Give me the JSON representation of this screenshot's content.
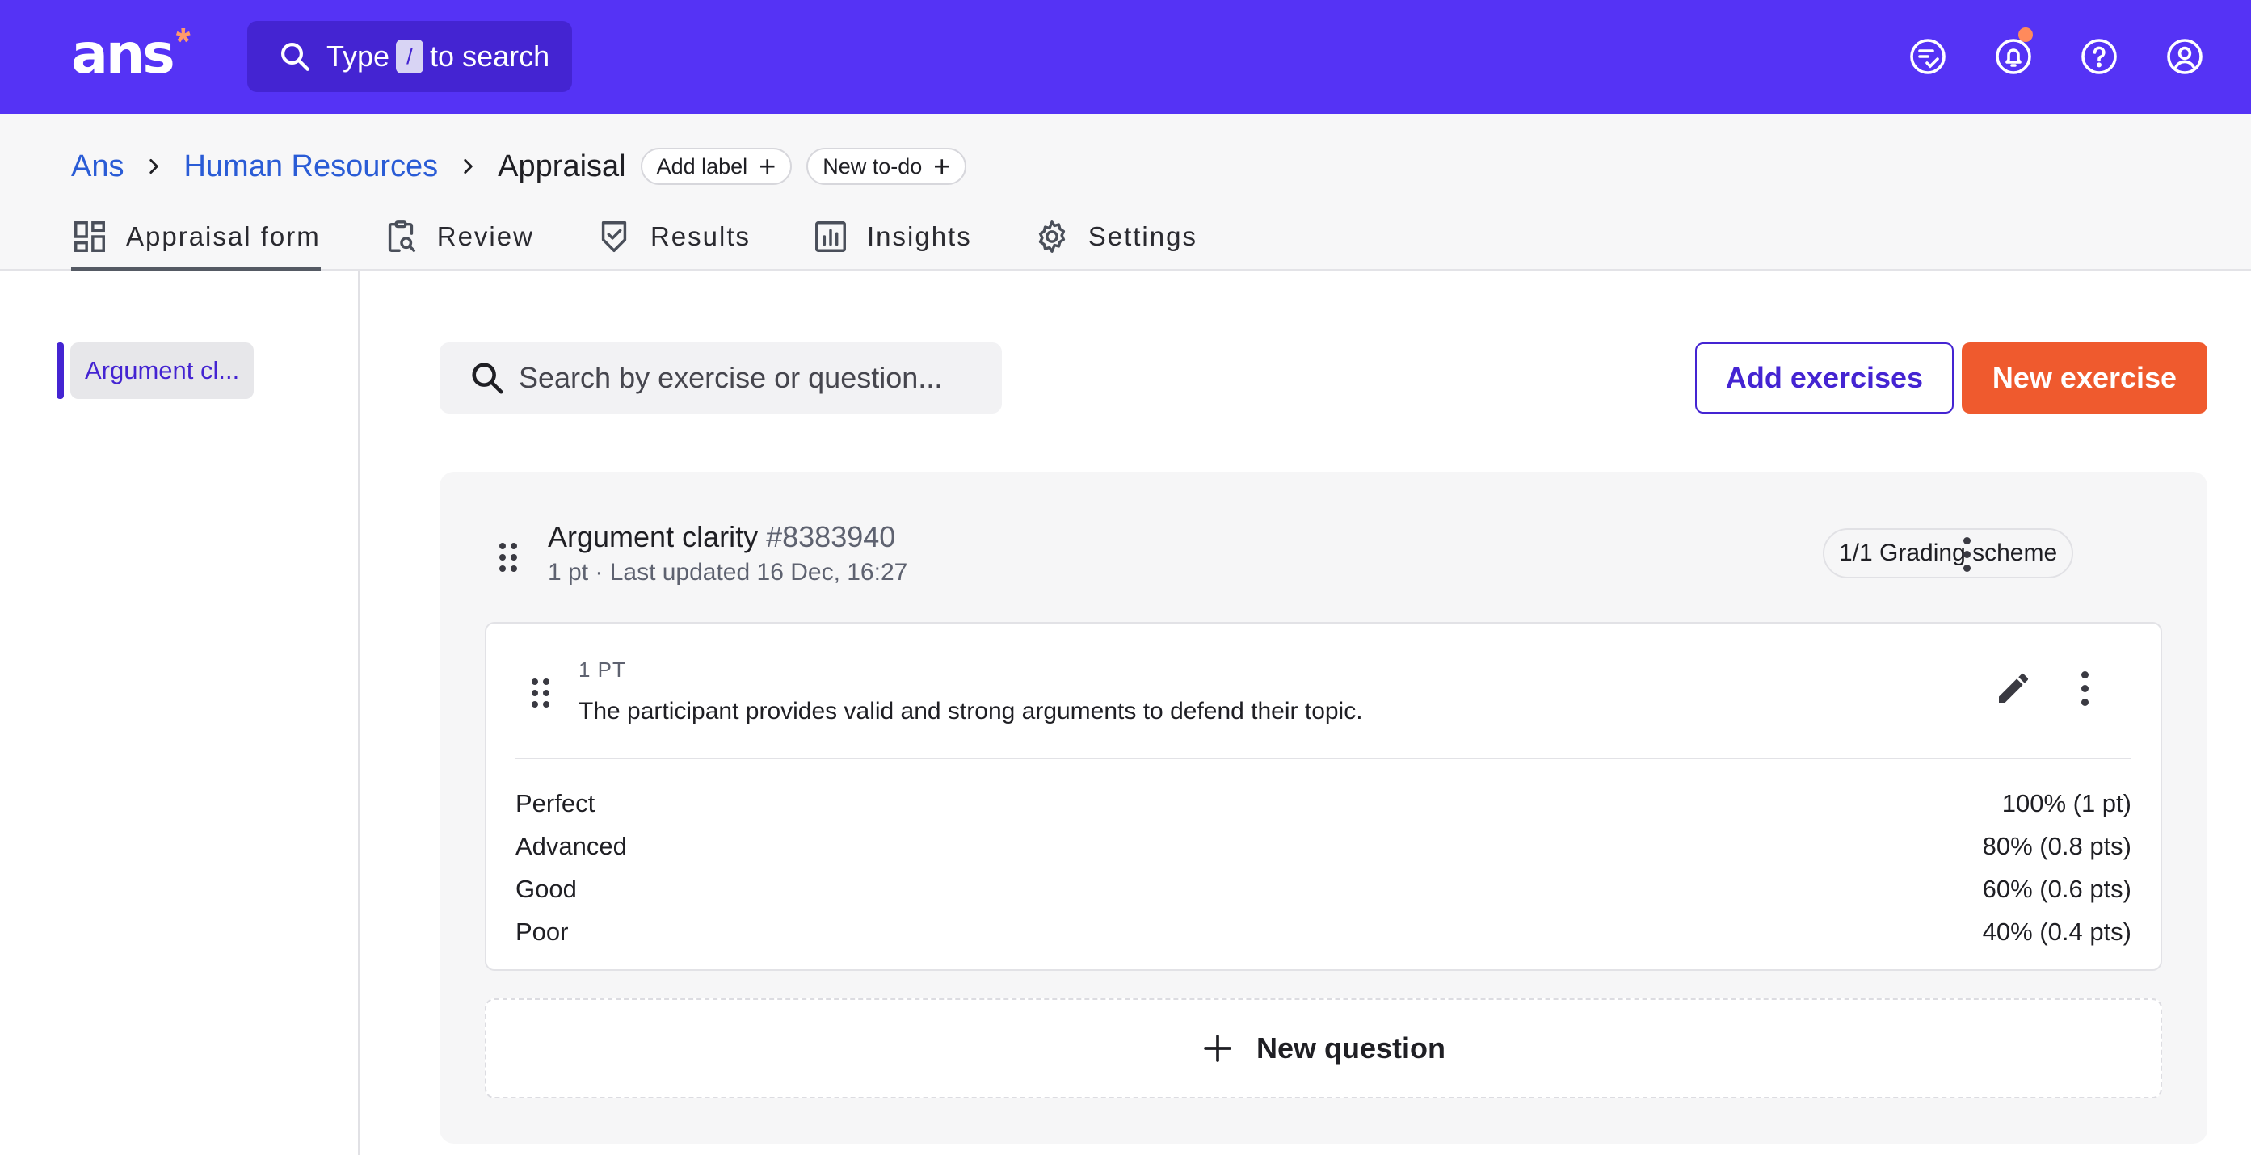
{
  "app": {
    "logo_text": "ans",
    "logo_mark": "*",
    "search": {
      "prefix": "Type",
      "key": "/",
      "suffix": "to search"
    },
    "colors": {
      "brand": "#5533f5",
      "accent": "#ef5a2e",
      "link": "#2a5cd6",
      "notification_dot": "#ff8a5c"
    },
    "top_icons": [
      "todo-list-icon",
      "bell-icon",
      "help-icon",
      "account-icon"
    ]
  },
  "breadcrumb": {
    "items": [
      "Ans",
      "Human Resources"
    ],
    "current": "Appraisal",
    "add_label": "Add label",
    "new_todo": "New to-do"
  },
  "tabs": [
    {
      "label": "Appraisal form",
      "icon": "dashboard-icon",
      "active": true
    },
    {
      "label": "Review",
      "icon": "clipboard-search-icon",
      "active": false
    },
    {
      "label": "Results",
      "icon": "shield-check-icon",
      "active": false
    },
    {
      "label": "Insights",
      "icon": "bar-chart-icon",
      "active": false
    },
    {
      "label": "Settings",
      "icon": "gear-icon",
      "active": false
    }
  ],
  "sidebar": {
    "items": [
      {
        "label": "Argument cl...",
        "active": true
      }
    ]
  },
  "main": {
    "search_placeholder": "Search by exercise or question...",
    "add_exercises": "Add exercises",
    "new_exercise": "New exercise",
    "exercise": {
      "title": "Argument clarity",
      "id": "#8383940",
      "meta": "1 pt · Last updated 16 Dec, 16:27",
      "grading_chip": "1/1 Grading scheme",
      "question": {
        "points": "1 PT",
        "text": "The participant provides valid and strong arguments to defend their topic.",
        "scheme": [
          {
            "label": "Perfect",
            "value": "100% (1 pt)"
          },
          {
            "label": "Advanced",
            "value": "80% (0.8 pts)"
          },
          {
            "label": "Good",
            "value": "60% (0.6 pts)"
          },
          {
            "label": "Poor",
            "value": "40% (0.4 pts)"
          }
        ]
      },
      "new_question": "New question"
    }
  }
}
